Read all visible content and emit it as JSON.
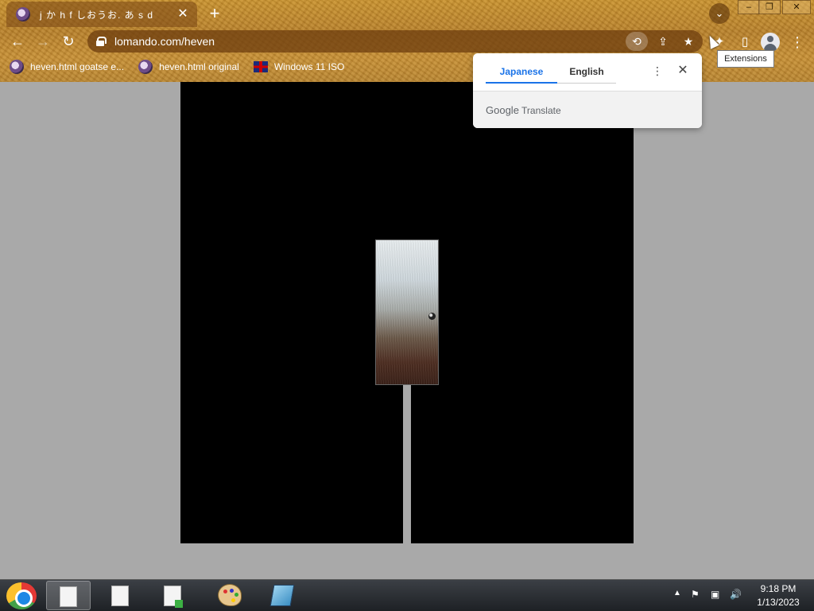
{
  "tab": {
    "title": "j か h f しおうお. あ s d",
    "close": "✕"
  },
  "newtab": "+",
  "tabsearch": "⌄",
  "window": {
    "min": "–",
    "max": "❐",
    "close": "✕"
  },
  "nav": {
    "back": "←",
    "forward": "→",
    "reload": "↻"
  },
  "address": {
    "url": "lomando.com/heven"
  },
  "omnibox_icons": {
    "translate": "⟲",
    "share": "⇪",
    "star": "★"
  },
  "toolbar": {
    "extensions": "✦",
    "sidepanel": "▯",
    "menu": "⋮"
  },
  "bookmarks": [
    {
      "label": "heven.html goatse e..."
    },
    {
      "label": "heven.html original"
    },
    {
      "label": "Windows 11 ISO"
    }
  ],
  "tooltip": "Extensions",
  "translate_popup": {
    "tab_source": "Japanese",
    "tab_target": "English",
    "more": "⋮",
    "close": "✕",
    "brand_google": "Google",
    "brand_translate": "Translate"
  },
  "tray": {
    "up": "▲",
    "flag": "⚑",
    "network": "▣",
    "volume": "🔊"
  },
  "clock": {
    "time": "9:18 PM",
    "date": "1/13/2023"
  }
}
